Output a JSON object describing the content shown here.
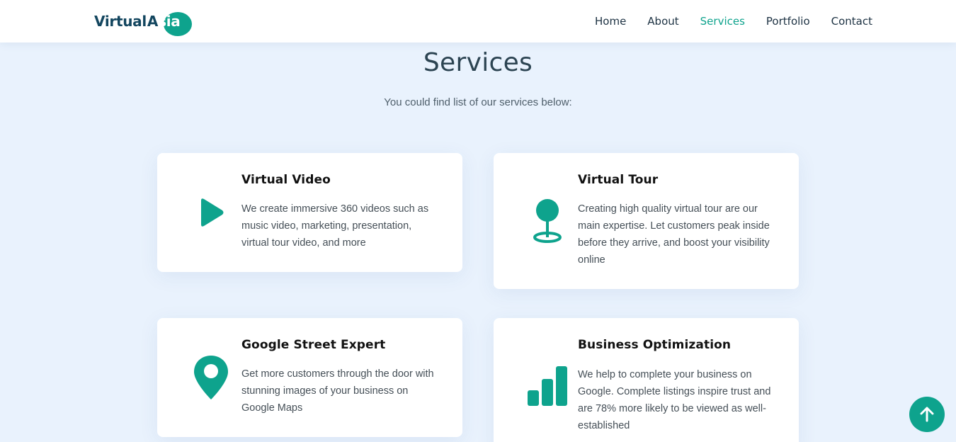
{
  "brand": {
    "logo_part1": "Virtual",
    "logo_part2_first": "A",
    "logo_part2_rest": "sia",
    "primary_color": "#0ea38d",
    "dark_color": "#13465f"
  },
  "nav": {
    "items": [
      {
        "label": "Home",
        "active": false
      },
      {
        "label": "About",
        "active": false
      },
      {
        "label": "Services",
        "active": true
      },
      {
        "label": "Portfolio",
        "active": false
      },
      {
        "label": "Contact",
        "active": false
      }
    ]
  },
  "services": {
    "title": "Services",
    "subtitle": "You could find list of our services below:",
    "cards": [
      {
        "icon": "play-icon",
        "title": "Virtual Video",
        "description": "We create immersive 360 videos such as music video, marketing, presentation, virtual tour video, and more"
      },
      {
        "icon": "location-pin-icon",
        "title": "Virtual Tour",
        "description": "Creating high quality virtual tour are our main expertise. Let customers peak inside before they arrive, and boost your visibility online"
      },
      {
        "icon": "map-marker-icon",
        "title": "Google Street Expert",
        "description": "Get more customers through the door with stunning images of your business on Google Maps"
      },
      {
        "icon": "bar-chart-icon",
        "title": "Business Optimization",
        "description": "We help to complete your business on Google. Complete listings inspire trust and are 78% more likely to be viewed as well-established"
      }
    ]
  },
  "scroll_top": {
    "icon": "arrow-up-icon"
  }
}
